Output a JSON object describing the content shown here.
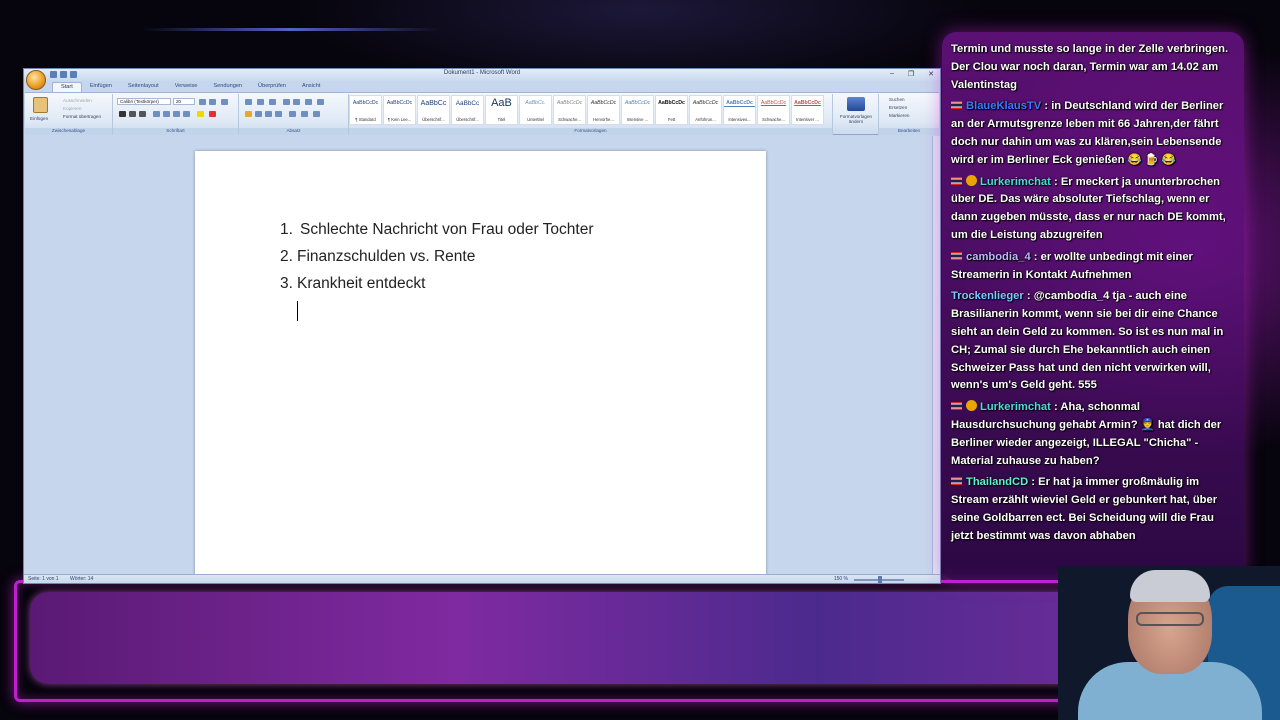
{
  "word": {
    "window_title": "Dokument1 - Microsoft Word",
    "win_buttons": [
      "–",
      "❐",
      "✕"
    ],
    "tabs": [
      "Start",
      "Einfügen",
      "Seitenlayout",
      "Verweise",
      "Sendungen",
      "Überprüfen",
      "Ansicht"
    ],
    "clipboard": {
      "paste": "Einfügen",
      "cut": "Ausschneiden",
      "copy": "Kopieren",
      "format_painter": "Format übertragen",
      "group": "Zwischenablage"
    },
    "font": {
      "name": "Calibri (Textkörper)",
      "size": "20",
      "group": "Schriftart"
    },
    "paragraph_group": "Absatz",
    "styles": [
      {
        "preview": "AaBbCcDc",
        "name": "¶ Standard"
      },
      {
        "preview": "AaBbCcDc",
        "name": "¶ Kein Lee..."
      },
      {
        "preview": "AaBbCc",
        "name": "Überschrif..."
      },
      {
        "preview": "AaBbCc",
        "name": "Überschrif..."
      },
      {
        "preview": "AaB",
        "name": "Titel"
      },
      {
        "preview": "AaBbCc.",
        "name": "Untertitel"
      },
      {
        "preview": "AaBbCcDc",
        "name": "Schwache..."
      },
      {
        "preview": "AaBbCcDc",
        "name": "Hervorhe..."
      },
      {
        "preview": "AaBbCcDc",
        "name": "Intensive ..."
      },
      {
        "preview": "AaBbCcDc",
        "name": "Fett"
      },
      {
        "preview": "AaBbCcDc",
        "name": "Anführun..."
      },
      {
        "preview": "AaBbCcDc",
        "name": "Intensives..."
      },
      {
        "preview": "AaBbCcDc",
        "name": "Schwache..."
      },
      {
        "preview": "AaBbCcDc",
        "name": "Intensiver ..."
      }
    ],
    "styles_group": "Formatvorlagen",
    "change_styles": "Formatvorlagen ändern",
    "editing": {
      "find": "Suchen",
      "replace": "Ersetzen",
      "select": "Markieren",
      "group": "Bearbeiten"
    },
    "document": {
      "items": [
        {
          "num": "1.",
          "text": "Schlechte Nachricht von Frau oder Tochter"
        },
        {
          "num": "2.",
          "text": "Finanzschulden vs. Rente"
        },
        {
          "num": "3.",
          "text": "Krankheit entdeckt"
        }
      ]
    },
    "status": {
      "page": "Seite: 1 von 1",
      "words": "Wörter: 14",
      "zoom": "150 %"
    }
  },
  "chat": {
    "messages": [
      {
        "flag": "",
        "badge": false,
        "user": "",
        "user_color": "#ffffff",
        "text": "Termin und musste so lange in der Zelle verbringen. Der Clou war noch daran, Termin war am 14.02 am Valentinstag"
      },
      {
        "flag": "th",
        "badge": false,
        "user": "BlaueKlausTV",
        "user_color": "#3a7bff",
        "text": "in Deutschland wird der Berliner an der Armutsgrenze leben mit 66 Jahren,der fährt doch nur dahin um was zu klären,sein Lebensende wird er im Berliner Eck genießen 😂 🍺 😂"
      },
      {
        "flag": "th",
        "badge": true,
        "user": "Lurkerimchat",
        "user_color": "#4fd8d8",
        "text": "Er meckert ja ununterbrochen über DE. Das wäre absoluter Tiefschlag, wenn er dann zugeben müsste, dass er nur nach DE kommt, um die Leistung abzugreifen"
      },
      {
        "flag": "th",
        "badge": false,
        "user": "cambodia_4",
        "user_color": "#b9b6ff",
        "text": "er wollte unbedingt mit einer Streamerin in Kontakt Aufnehmen"
      },
      {
        "flag": "",
        "badge": false,
        "user": "Trockenlieger",
        "user_color": "#7ec6ff",
        "text": "@cambodia_4 tja - auch eine Brasilianerin kommt, wenn sie bei dir eine Chance sieht an dein Geld zu kommen. So ist es nun mal in CH; Zumal sie durch Ehe bekanntlich auch einen Schweizer Pass hat und den nicht verwirken will, wenn's um's Geld geht. 555"
      },
      {
        "flag": "th",
        "badge": true,
        "user": "Lurkerimchat",
        "user_color": "#4fd8d8",
        "text": "Aha, schonmal Hausdurchsuchung gehabt Armin? 👮 hat dich der Berliner wieder angezeigt, ILLEGAL \"Chicha\" - Material zuhause zu haben?"
      },
      {
        "flag": "th",
        "badge": false,
        "user": "ThailandCD",
        "user_color": "#5ff0d0",
        "text": "Er hat ja immer großmäulig im Stream erzählt wieviel Geld er gebunkert hat, über seine Goldbarren ect. Bei Scheidung will die Frau jetzt bestimmt was davon abhaben"
      }
    ]
  }
}
